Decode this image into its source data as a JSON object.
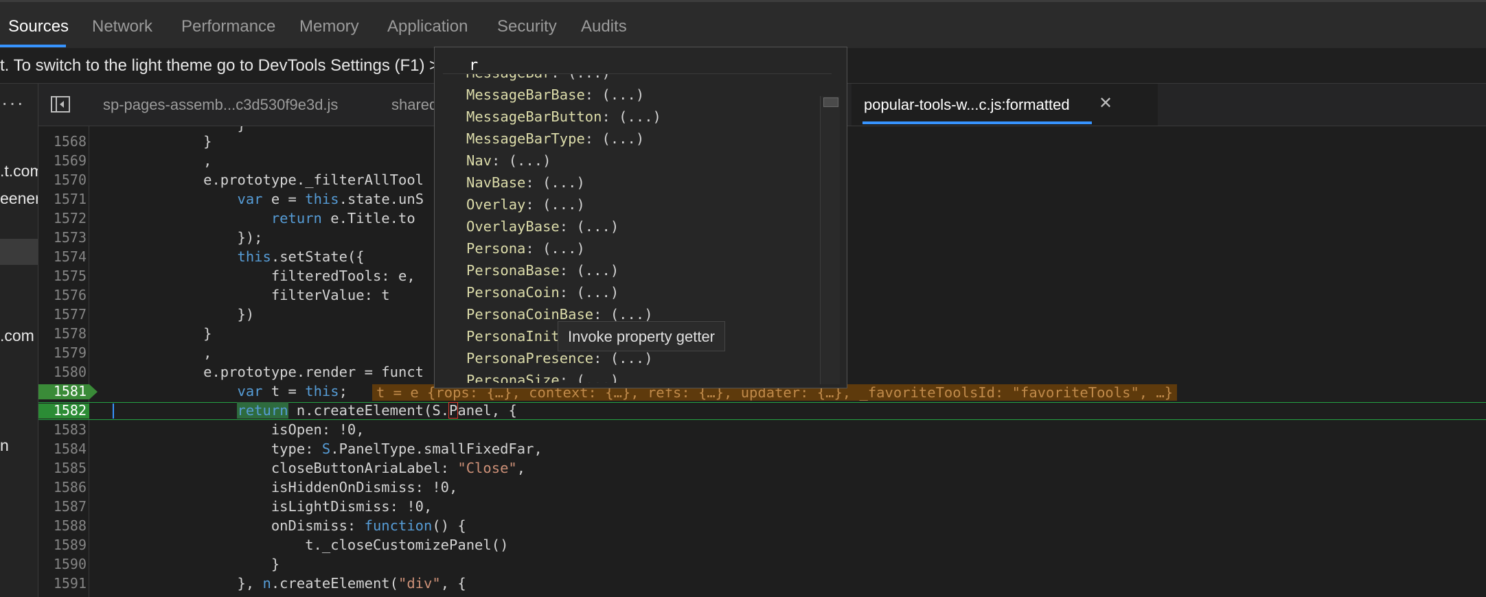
{
  "top_tabs": [
    "Sources",
    "Network",
    "Performance",
    "Memory",
    "Application",
    "Security",
    "Audits"
  ],
  "infobar_text": "t. To switch to the light theme go to DevTools Settings (F1) >",
  "sidebar": {
    "dots": "···",
    "items": [
      ".t.com",
      "eenerg",
      ".com",
      "n"
    ]
  },
  "file_tabs": [
    "sp-pages-assemb...c3d530f9e3d.js",
    "shared",
    "popular-tools-w...c.js:formatted"
  ],
  "editor": {
    "lines": [
      "1568",
      "1569",
      "1570",
      "1571",
      "1572",
      "1573",
      "1574",
      "1575",
      "1576",
      "1577",
      "1578",
      "1579",
      "1580",
      "1581",
      "1582",
      "1583",
      "1584",
      "1585",
      "1586",
      "1587",
      "1588",
      "1589",
      "1590",
      "1591"
    ],
    "inline_value": "t = e {rops: {…}, context: {…}, refs: {…}, updater: {…}, _favoriteToolsId: \"favoriteTools\", …}"
  },
  "autocomplete": {
    "prefix": "r",
    "items": [
      {
        "key": "MessageBar",
        "val": ": (...)"
      },
      {
        "key": "MessageBarBase",
        "val": ": (...)"
      },
      {
        "key": "MessageBarButton",
        "val": ": (...)"
      },
      {
        "key": "MessageBarType",
        "val": ": (...)"
      },
      {
        "key": "Nav",
        "val": ": (...)"
      },
      {
        "key": "NavBase",
        "val": ": (...)"
      },
      {
        "key": "Overlay",
        "val": ": (...)"
      },
      {
        "key": "OverlayBase",
        "val": ": (...)"
      },
      {
        "key": "Persona",
        "val": ": (...)"
      },
      {
        "key": "PersonaBase",
        "val": ": (...)"
      },
      {
        "key": "PersonaCoin",
        "val": ": (...)"
      },
      {
        "key": "PersonaCoinBase",
        "val": ": (...)"
      },
      {
        "key": "PersonaInit",
        "val": ""
      },
      {
        "key": "PersonaPresence",
        "val": ": (...)"
      },
      {
        "key": "PersonaSize",
        "val": ": (...)"
      }
    ]
  },
  "tooltip": "Invoke property getter",
  "colors": {
    "accent": "#3794ff",
    "breakpoint": "#3a8b38",
    "exec_line": "#25a244",
    "inline_value_bg": "#5e3a0c"
  }
}
